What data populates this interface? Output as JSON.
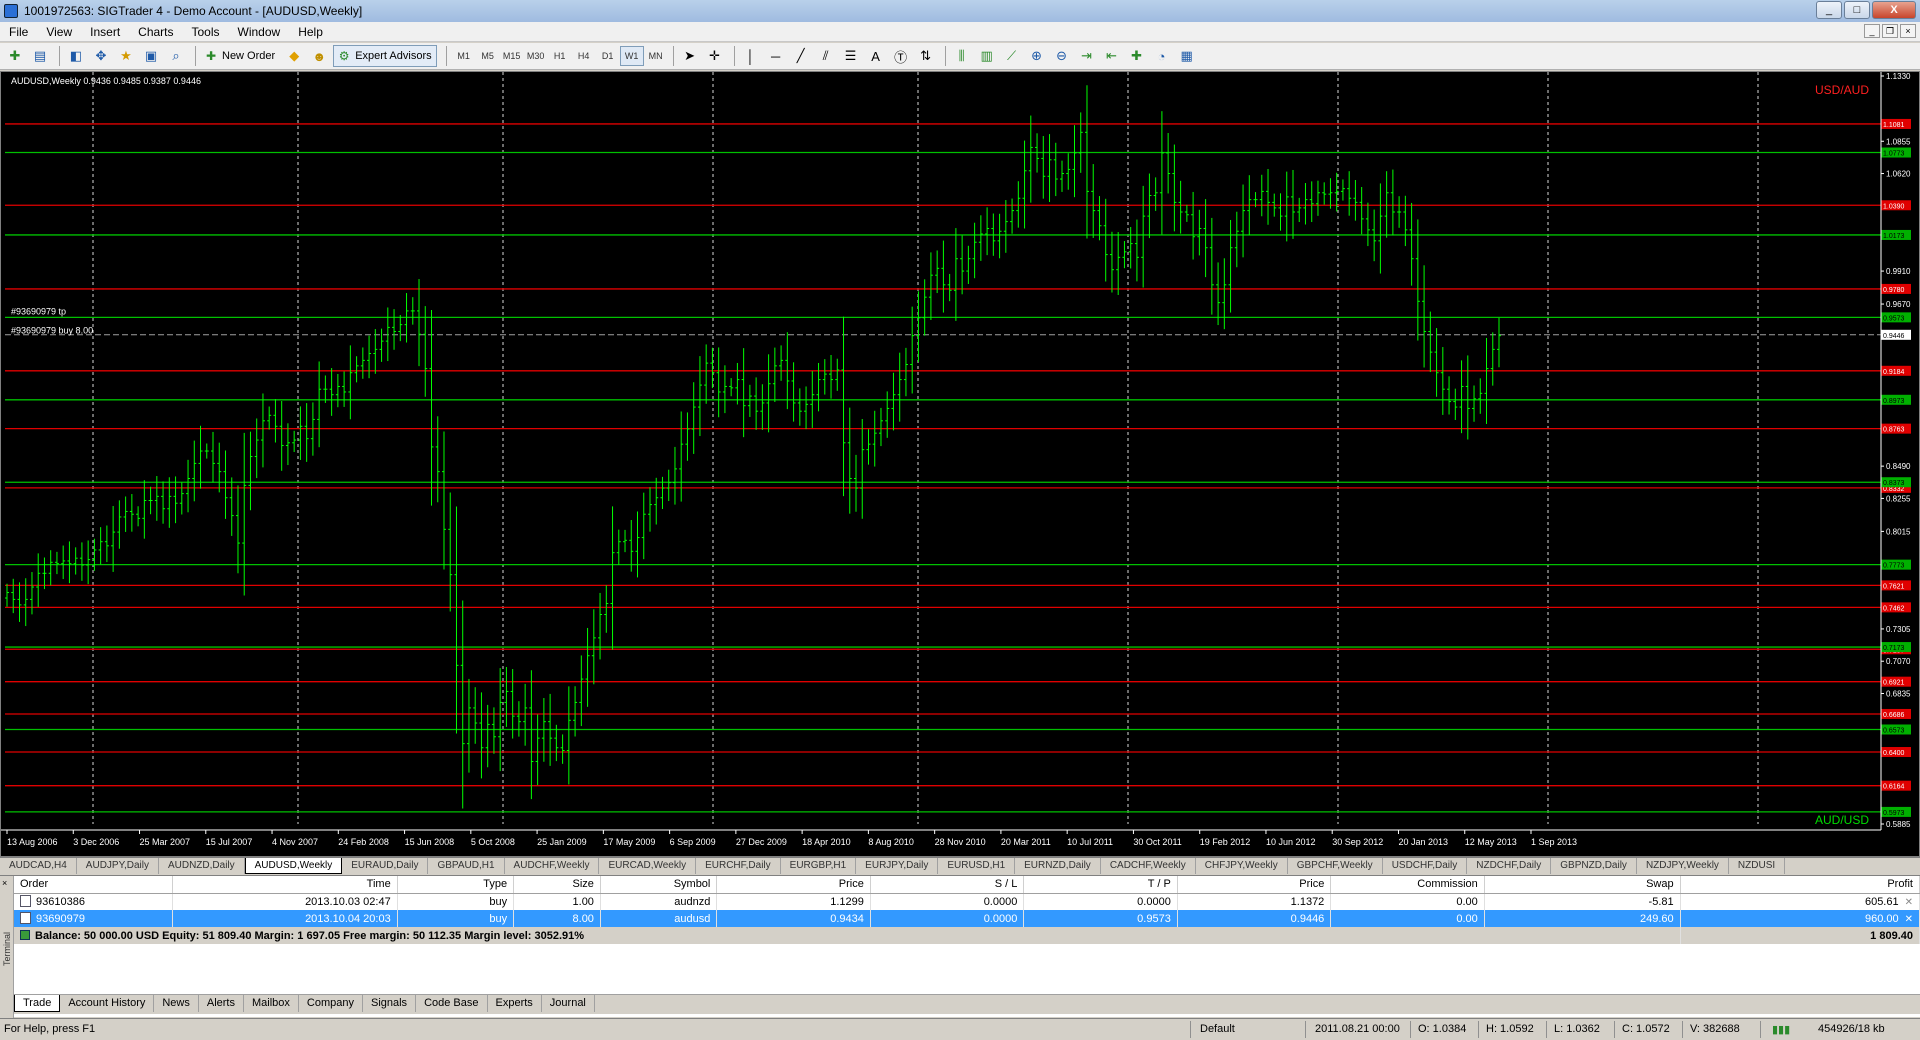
{
  "window": {
    "title": "1001972563: SIGTrader 4 - Demo Account - [AUDUSD,Weekly]",
    "buttons": [
      "_",
      "□",
      "X"
    ]
  },
  "menu": [
    "File",
    "View",
    "Insert",
    "Charts",
    "Tools",
    "Window",
    "Help"
  ],
  "toolbar": {
    "new_order": "New Order",
    "expert_advisors": "Expert Advisors",
    "timeframes": [
      "M1",
      "M5",
      "M15",
      "M30",
      "H1",
      "H4",
      "D1",
      "W1",
      "MN"
    ],
    "active_timeframe": "W1"
  },
  "chart": {
    "header": "AUDUSD,Weekly  0.9436 0.9485 0.9387 0.9446",
    "label_top": "USD/AUD",
    "label_bottom": "AUD/USD",
    "order_tp": "#93690979 tp",
    "order_buy": "#93690979 buy 8.00",
    "current_price": "0.9446",
    "colors": {
      "background": "#000000",
      "candle": "#00ff00",
      "support": "#00c000",
      "resistance": "#e00000",
      "grid": "#ffffff"
    },
    "price_ticks": [
      "1.1330",
      "1.0855",
      "1.0620",
      "0.9910",
      "0.9670",
      "0.8490",
      "0.8255",
      "0.8015",
      "0.7305",
      "0.7070",
      "0.6835",
      "0.5885"
    ],
    "date_ticks": [
      "13 Aug 2006",
      "3 Dec 2006",
      "25 Mar 2007",
      "15 Jul 2007",
      "4 Nov 2007",
      "24 Feb 2008",
      "15 Jun 2008",
      "5 Oct 2008",
      "25 Jan 2009",
      "17 May 2009",
      "6 Sep 2009",
      "27 Dec 2009",
      "18 Apr 2010",
      "8 Aug 2010",
      "28 Nov 2010",
      "20 Mar 2011",
      "10 Jul 2011",
      "30 Oct 2011",
      "19 Feb 2012",
      "10 Jun 2012",
      "30 Sep 2012",
      "20 Jan 2013",
      "12 May 2013",
      "1 Sep 2013"
    ],
    "red_levels": [
      {
        "price": 1.0981,
        "label": "1.1081"
      },
      {
        "price": 1.0389,
        "label": "1.0390"
      },
      {
        "price": 0.978,
        "label": "0.9780"
      },
      {
        "price": 0.9184,
        "label": "0.9184"
      },
      {
        "price": 0.8763,
        "label": "0.8763"
      },
      {
        "price": 0.8332,
        "label": "0.8332"
      },
      {
        "price": 0.7622,
        "label": "0.7621"
      },
      {
        "price": 0.7462,
        "label": "0.7462"
      },
      {
        "price": 0.7157,
        "label": "0.7157"
      },
      {
        "price": 0.6921,
        "label": "0.6921"
      },
      {
        "price": 0.6686,
        "label": "0.6686"
      },
      {
        "price": 0.6409,
        "label": "0.6400"
      },
      {
        "price": 0.6164,
        "label": "0.6164"
      }
    ],
    "green_levels": [
      {
        "price": 1.0773,
        "label": "1.0773"
      },
      {
        "price": 1.0173,
        "label": "1.0173"
      },
      {
        "price": 0.9573,
        "label": "0.9573"
      },
      {
        "price": 0.8973,
        "label": "0.8973"
      },
      {
        "price": 0.8373,
        "label": "0.8373"
      },
      {
        "price": 0.7773,
        "label": "0.7773"
      },
      {
        "price": 0.7173,
        "label": "0.7173"
      },
      {
        "price": 0.6573,
        "label": "0.6573"
      },
      {
        "price": 0.5973,
        "label": "0.5973"
      }
    ],
    "close_prices": [
      0.757,
      0.752,
      0.748,
      0.752,
      0.761,
      0.771,
      0.771,
      0.779,
      0.778,
      0.78,
      0.778,
      0.782,
      0.777,
      0.781,
      0.788,
      0.794,
      0.791,
      0.801,
      0.812,
      0.816,
      0.814,
      0.811,
      0.824,
      0.824,
      0.827,
      0.818,
      0.827,
      0.822,
      0.829,
      0.84,
      0.851,
      0.86,
      0.86,
      0.851,
      0.845,
      0.826,
      0.813,
      0.793,
      0.835,
      0.856,
      0.868,
      0.882,
      0.886,
      0.878,
      0.864,
      0.866,
      0.868,
      0.878,
      0.869,
      0.883,
      0.905,
      0.905,
      0.901,
      0.907,
      0.903,
      0.917,
      0.922,
      0.926,
      0.931,
      0.934,
      0.94,
      0.95,
      0.947,
      0.952,
      0.962,
      0.962,
      0.945,
      0.92,
      0.863,
      0.845,
      0.803,
      0.77,
      0.704,
      0.647,
      0.673,
      0.662,
      0.644,
      0.661,
      0.652,
      0.677,
      0.685,
      0.667,
      0.663,
      0.673,
      0.634,
      0.651,
      0.663,
      0.651,
      0.644,
      0.642,
      0.664,
      0.677,
      0.694,
      0.711,
      0.724,
      0.741,
      0.749,
      0.786,
      0.794,
      0.795,
      0.787,
      0.797,
      0.814,
      0.821,
      0.826,
      0.833,
      0.837,
      0.847,
      0.865,
      0.876,
      0.892,
      0.908,
      0.924,
      0.917,
      0.903,
      0.907,
      0.906,
      0.912,
      0.893,
      0.9,
      0.889,
      0.895,
      0.909,
      0.922,
      0.926,
      0.911,
      0.895,
      0.889,
      0.894,
      0.901,
      0.912,
      0.916,
      0.912,
      0.919,
      0.866,
      0.84,
      0.833,
      0.861,
      0.865,
      0.873,
      0.882,
      0.891,
      0.901,
      0.912,
      0.923,
      0.944,
      0.957,
      0.972,
      0.988,
      0.993,
      0.981,
      0.977,
      1.0,
      0.991,
      1.0,
      1.012,
      1.018,
      1.022,
      1.013,
      1.02,
      1.027,
      1.035,
      1.044,
      1.064,
      1.081,
      1.073,
      1.06,
      1.072,
      1.058,
      1.062,
      1.065,
      1.077,
      1.092,
      1.049,
      1.035,
      1.024,
      1.003,
      0.992,
      1.001,
      1.005,
      1.011,
      1.001,
      1.031,
      1.046,
      1.048,
      1.077,
      1.062,
      1.041,
      1.034,
      1.032,
      1.016,
      1.022,
      1.008,
      0.981,
      0.968,
      0.981,
      1.008,
      1.02,
      1.035,
      1.043,
      1.043,
      1.049,
      1.041,
      1.037,
      1.031,
      1.045,
      1.034,
      1.037,
      1.043,
      1.04,
      1.048,
      1.047,
      1.048,
      1.049,
      1.051,
      1.044,
      1.041,
      1.029,
      1.021,
      1.013,
      1.031,
      1.048,
      1.034,
      1.034,
      1.021,
      1.0,
      0.969,
      0.947,
      0.932,
      0.917,
      0.905,
      0.896,
      0.892,
      0.907,
      0.891,
      0.898,
      0.902,
      0.92,
      0.934,
      0.944
    ]
  },
  "chart_tabs": [
    "AUDCAD,H4",
    "AUDJPY,Daily",
    "AUDNZD,Daily",
    "AUDUSD,Weekly",
    "EURAUD,Daily",
    "GBPAUD,H1",
    "AUDCHF,Weekly",
    "EURCAD,Weekly",
    "EURCHF,Daily",
    "EURGBP,H1",
    "EURJPY,Daily",
    "EURUSD,H1",
    "EURNZD,Daily",
    "CADCHF,Weekly",
    "CHFJPY,Weekly",
    "GBPCHF,Weekly",
    "USDCHF,Daily",
    "NZDCHF,Daily",
    "GBPNZD,Daily",
    "NZDJPY,Weekly",
    "NZDUSI"
  ],
  "active_chart_tab": "AUDUSD,Weekly",
  "terminal": {
    "side_label": "Terminal",
    "columns": [
      "Order",
      "Time",
      "Type",
      "Size",
      "Symbol",
      "Price",
      "S / L",
      "T / P",
      "Price",
      "Commission",
      "Swap",
      "Profit"
    ],
    "rows": [
      [
        "93610386",
        "2013.10.03 02:47",
        "buy",
        "1.00",
        "audnzd",
        "1.1299",
        "0.0000",
        "0.0000",
        "1.1372",
        "0.00",
        "-5.81",
        "605.61"
      ],
      [
        "93690979",
        "2013.10.04 20:03",
        "buy",
        "8.00",
        "audusd",
        "0.9434",
        "0.0000",
        "0.9573",
        "0.9446",
        "0.00",
        "249.60",
        "960.00"
      ]
    ],
    "balance_text": "Balance: 50 000.00 USD  Equity: 51 809.40  Margin: 1 697.05  Free margin: 50 112.35  Margin level: 3052.91%",
    "total_profit": "1 809.40",
    "tabs": [
      "Trade",
      "Account History",
      "News",
      "Alerts",
      "Mailbox",
      "Company",
      "Signals",
      "Code Base",
      "Experts",
      "Journal"
    ],
    "active_tab": "Trade"
  },
  "status": {
    "help": "For Help, press F1",
    "profile": "Default",
    "datetime": "2011.08.21 00:00",
    "open": "O: 1.0384",
    "high": "H: 1.0592",
    "low": "L: 1.0362",
    "close": "C: 1.0572",
    "volume": "V: 382688",
    "traffic": "454926/18 kb"
  }
}
